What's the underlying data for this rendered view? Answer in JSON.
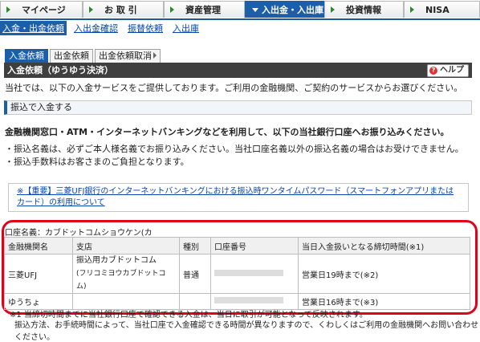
{
  "nav": {
    "tabs": [
      {
        "label": "マイページ",
        "active": false
      },
      {
        "label": "お 取 引",
        "active": false
      },
      {
        "label": "資産管理",
        "active": false
      },
      {
        "label": "入出金・入出庫",
        "active": true
      },
      {
        "label": "投資情報",
        "active": false
      },
      {
        "label": "NISA",
        "active": false
      }
    ]
  },
  "subnav": {
    "items": [
      "入金・出金依頼",
      "入出金確認",
      "振替依頼",
      "入出庫"
    ]
  },
  "tabs2": {
    "items": [
      "入金依頼",
      "出金依頼",
      "出金依頼取消"
    ]
  },
  "header": {
    "title": "入金依頼（ゆうゆう決済）",
    "help_label": "ヘルプ"
  },
  "intro": "当社では、以下の入金サービスをご提供しております。ご利用の金融機関、ご契約のサービスからお選びください。",
  "section": {
    "title": "振込で入金する"
  },
  "lead": "金融機関窓口・ATM・インターネットバンキングなどを利用して、以下の当社銀行口座へお振り込みください。",
  "notes": [
    "・振込名義は、必ずご本人様名義でお振り込みください。当社口座名義以外の振込名義の場合はお受けできません。",
    "・振込手数料はお客さまのご負担となります。"
  ],
  "warning": {
    "text": "※【重要】三菱UFJ銀行のインターネットバンキングにおける振込時ワンタイムパスワード（スマートフォンアプリまたはカード）の利用について"
  },
  "account": {
    "holder": "口座名義：カブドットコムショウケン(カ"
  },
  "bank_table": {
    "headers": [
      "金融機関名",
      "支店",
      "種別",
      "口座番号",
      "当日入金扱いとなる締切時間(※1)"
    ],
    "rows": [
      {
        "bank": "三菱UFJ",
        "branch1": "振込用カブドットコム",
        "branch2": "(フリコミヨウカブドットコム)",
        "type": "普通",
        "cutoff": "営業日19時まで(※2)"
      },
      {
        "bank": "ゆうちょ",
        "branch1": "",
        "branch2": "",
        "type": "",
        "cutoff": "営業日16時まで(※3)"
      }
    ]
  },
  "footnotes": [
    "※1 当締切時間までに当社銀行口座で確認できる入金は、当日に取引が可能となって反映されます。",
    "振込方法、お手続時間によって、当社口座で入金確認できる時間が異なりますので、くわしくはご利用の金融機関へお問い合わせください。"
  ],
  "colors": {
    "accent": "#1c5ea8",
    "highlight": "#e3001b",
    "warning": "#cc0000"
  }
}
